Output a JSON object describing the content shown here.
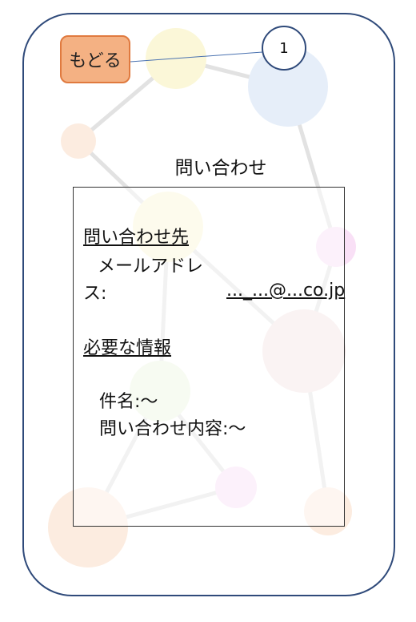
{
  "back_button": {
    "label": "もどる"
  },
  "callout": {
    "number": "1"
  },
  "screen": {
    "title": "問い合わせ"
  },
  "contact": {
    "heading": "問い合わせ先",
    "email_label_line1": "メールアドレ",
    "email_label_line2": "ス:",
    "email_value": "..._...@...co.jp"
  },
  "info": {
    "heading": "必要な情報",
    "subject": "件名:〜",
    "content": "問い合わせ内容:〜"
  }
}
